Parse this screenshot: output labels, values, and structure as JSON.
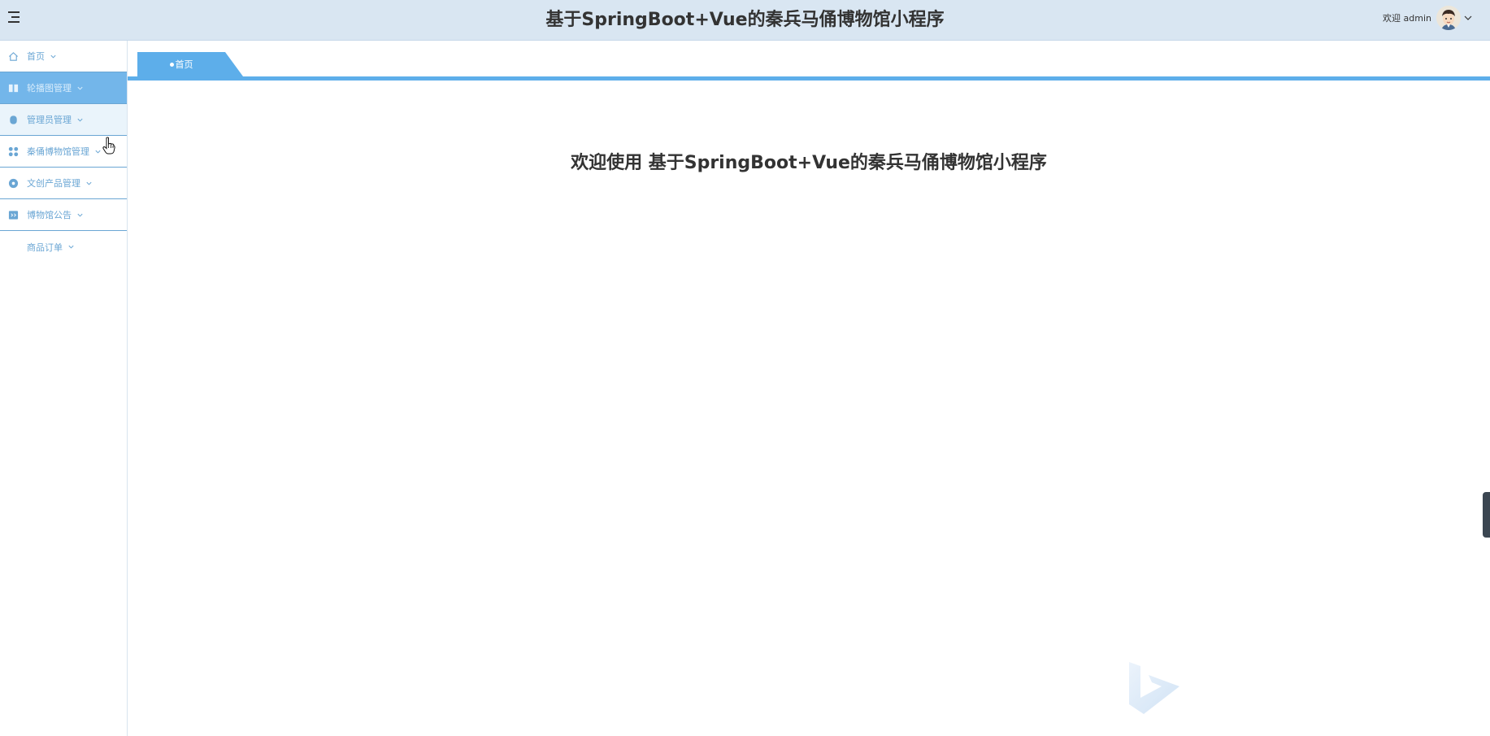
{
  "header": {
    "title": "基于SpringBoot+Vue的秦兵马俑博物馆小程序",
    "welcome": "欢迎 admin"
  },
  "sidebar": {
    "items": [
      {
        "label": "首页",
        "icon": "home-icon"
      },
      {
        "label": "轮播图管理",
        "icon": "carousel-icon"
      },
      {
        "label": "管理员管理",
        "icon": "admin-icon"
      },
      {
        "label": "秦俑博物馆管理",
        "icon": "grid-icon"
      },
      {
        "label": "文创产品管理",
        "icon": "product-icon"
      },
      {
        "label": "博物馆公告",
        "icon": "notice-icon"
      },
      {
        "label": "商品订单",
        "icon": ""
      }
    ]
  },
  "tabs": [
    {
      "label": "首页"
    }
  ],
  "main": {
    "heading": "欢迎使用 基于SpringBoot+Vue的秦兵马俑博物馆小程序"
  },
  "colors": {
    "header_bg": "#d9e6f2",
    "accent": "#5daeea",
    "active_menu_bg": "#73b6ea",
    "menu_text": "#6aa6d4"
  }
}
